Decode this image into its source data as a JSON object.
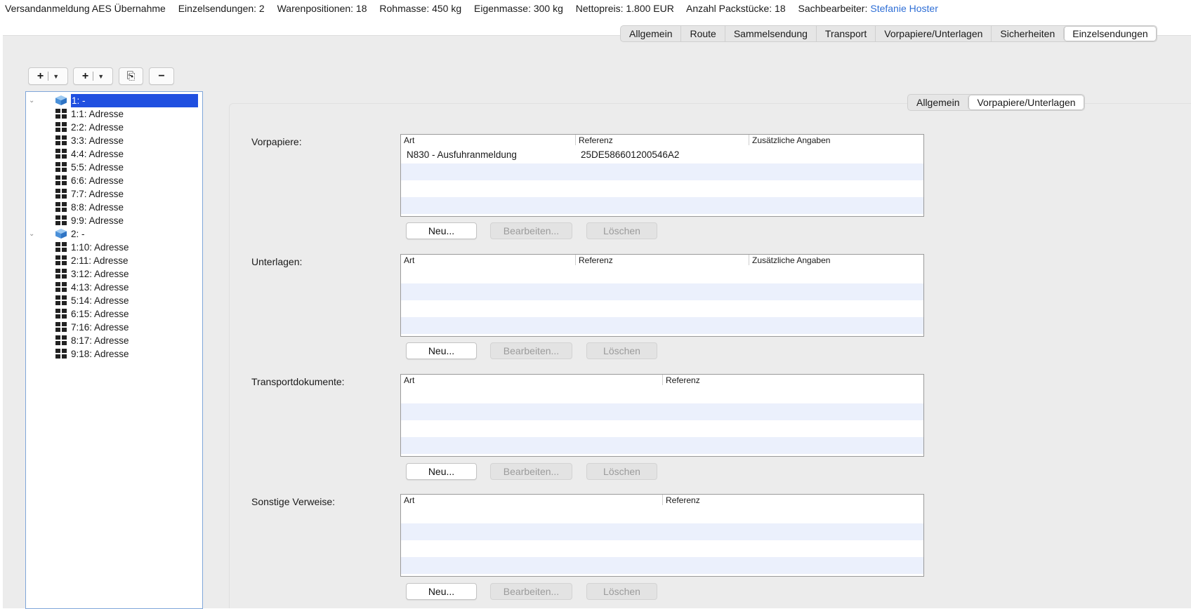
{
  "header": {
    "items": [
      "Versandanmeldung AES Übernahme",
      "Einzelsendungen: 2",
      "Warenpositionen: 18",
      "Rohmasse: 450 kg",
      "Eigenmasse: 300 kg",
      "Nettopreis: 1.800 EUR",
      "Anzahl Packstücke: 18"
    ],
    "user_label": "Sachbearbeiter:",
    "user_name": "Stefanie Hoster"
  },
  "top_tabs": [
    "Allgemein",
    "Route",
    "Sammelsendung",
    "Transport",
    "Vorpapiere/Unterlagen",
    "Sicherheiten",
    "Einzelsendungen"
  ],
  "top_tabs_active": "Einzelsendungen",
  "tree_toolbar": {
    "add1": "+",
    "add2": "+",
    "copy": "⎘",
    "remove": "−"
  },
  "tree": {
    "groups": [
      {
        "label": "1: -",
        "selected": true,
        "items": [
          "1:1: Adresse",
          "2:2: Adresse",
          "3:3: Adresse",
          "4:4: Adresse",
          "5:5: Adresse",
          "6:6: Adresse",
          "7:7: Adresse",
          "8:8: Adresse",
          "9:9: Adresse"
        ]
      },
      {
        "label": "2: -",
        "selected": false,
        "items": [
          "1:10: Adresse",
          "2:11: Adresse",
          "3:12: Adresse",
          "4:13: Adresse",
          "5:14: Adresse",
          "6:15: Adresse",
          "7:16: Adresse",
          "8:17: Adresse",
          "9:18: Adresse"
        ]
      }
    ]
  },
  "sub_tabs": [
    "Allgemein",
    "Vorpapiere/Unterlagen"
  ],
  "sub_tabs_active": "Vorpapiere/Unterlagen",
  "sections": [
    {
      "label": "Vorpapiere:",
      "columns": [
        "Art",
        "Referenz",
        "Zusätzliche Angaben"
      ],
      "rows": [
        [
          "N830 - Ausfuhranmeldung",
          "25DE586601200546A2",
          ""
        ]
      ]
    },
    {
      "label": "Unterlagen:",
      "columns": [
        "Art",
        "Referenz",
        "Zusätzliche Angaben"
      ],
      "rows": []
    },
    {
      "label": "Transportdokumente:",
      "columns": [
        "Art",
        "Referenz"
      ],
      "rows": []
    },
    {
      "label": "Sonstige Verweise:",
      "columns": [
        "Art",
        "Referenz"
      ],
      "rows": []
    }
  ],
  "buttons": {
    "new": "Neu...",
    "edit": "Bearbeiten...",
    "delete": "Löschen"
  },
  "colors": {
    "selection": "#1f4fe0",
    "user_link": "#2f6fd6",
    "row_alt": "#ebf0fc"
  }
}
